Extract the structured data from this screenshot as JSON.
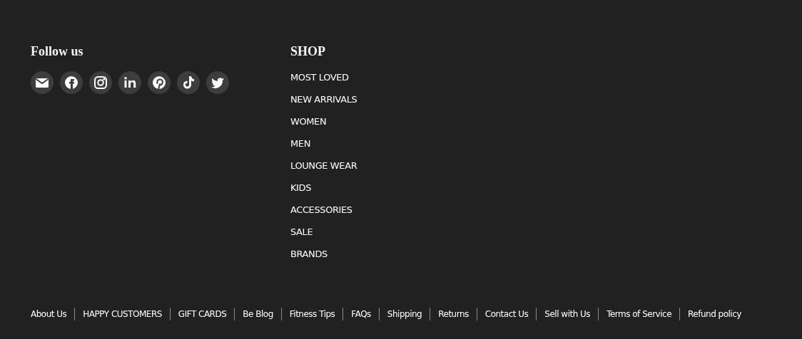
{
  "follow": {
    "title": "Follow us",
    "icons": [
      {
        "kind": "email"
      },
      {
        "kind": "facebook"
      },
      {
        "kind": "instagram"
      },
      {
        "kind": "linkedin"
      },
      {
        "kind": "pinterest"
      },
      {
        "kind": "tiktok"
      },
      {
        "kind": "twitter"
      }
    ]
  },
  "shop": {
    "title": "SHOP",
    "items": [
      "MOST LOVED",
      "NEW ARRIVALS",
      "WOMEN",
      "MEN",
      "LOUNGE WEAR",
      "KIDS",
      "ACCESSORIES",
      "SALE",
      "BRANDS"
    ]
  },
  "bottom_links": [
    "About Us",
    "HAPPY CUSTOMERS",
    "GIFT CARDS",
    "Be Blog",
    "Fitness Tips",
    "FAQs",
    "Shipping",
    "Returns",
    "Contact Us",
    "Sell with Us",
    "Terms of Service",
    "Refund policy"
  ]
}
